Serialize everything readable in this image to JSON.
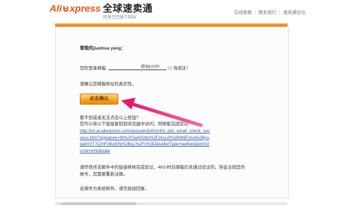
{
  "header": {
    "logo_ali": "Ali",
    "logo_express": "xpress",
    "logo_cn": "全球速卖通",
    "logo_sub": "阿里巴巴旗下网站",
    "nav": [
      "在线客服",
      "联系我们",
      "速卖通论坛"
    ]
  },
  "email": {
    "greeting": "尊敬的jianhua yang：",
    "email_prefix": "您的登录邮箱",
    "email_value": "@qq.com",
    "email_suffix": "待验证！",
    "confirm_prompt": "请确认您邮箱地址的真实性。",
    "confirm_button": "点击确认",
    "help_line1": "看不到或者无法点击以上按钮？",
    "help_line2": "您可以将以下链接复制到浏览器中访问，同样能完成验证！",
    "verify_link": "http://cn.ar.aliexpress.com/assuser/join/cnfm_join_email_check_success.htm?signature=fd%2F0a4A0tto%2Fzksu0%2BW6Fsha%2BpuqaimVT7t2mFz8uxPq%2BuL%2Fx%3D&sellerType=taobao&joinSource=wholesale",
    "notice_line1": "请尽快点击邮件中的链接继续完成验证，48小时后邮箱仍未通过验证的，将会注销您的",
    "notice_line2": "帐号，您需要重新注册。",
    "footer_note": "此邮件为系统邮件，请勿直接回复。"
  },
  "colors": {
    "brand_orange": "#e8531e",
    "bar_orange": "#f39419",
    "button_gold": "#f5a623",
    "link_blue": "#3060a8",
    "arrow_pink": "#e8186b"
  },
  "icons": {
    "logo_cart": "shopping-cart-icon",
    "annotation": "arrow-pointer"
  }
}
